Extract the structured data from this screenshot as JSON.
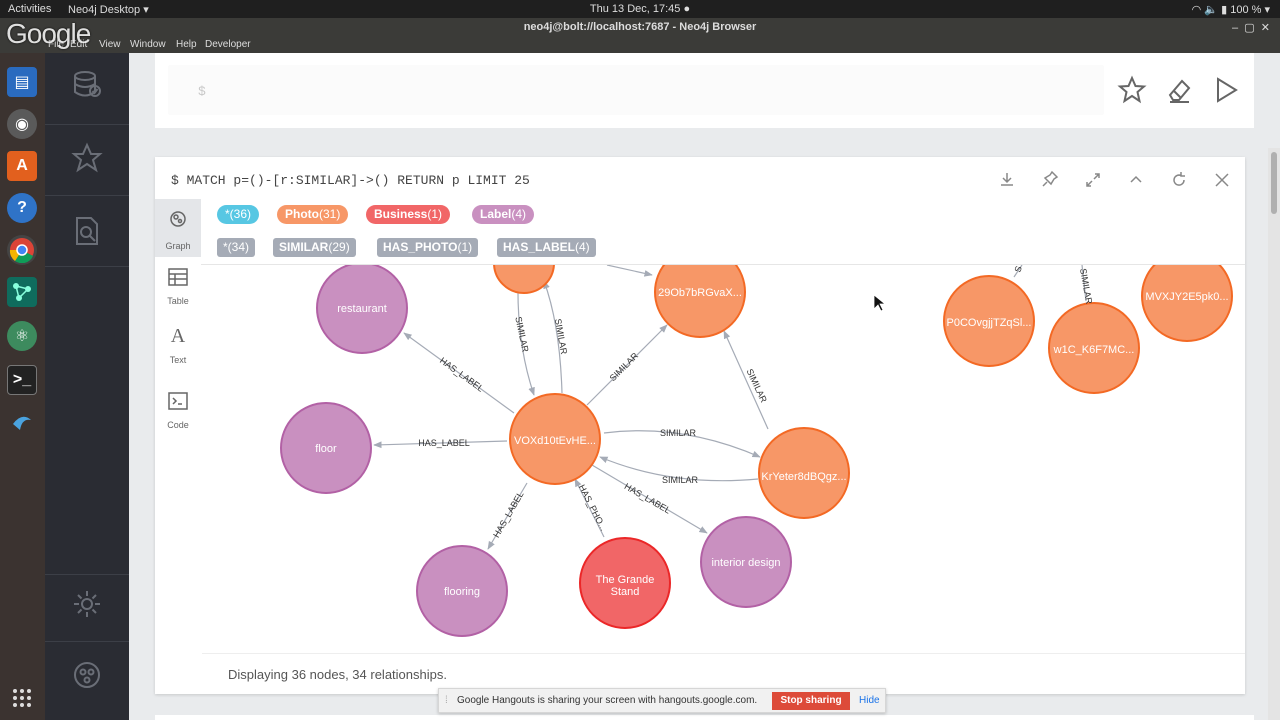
{
  "topbar": {
    "activities": "Activities",
    "app": "Neo4j Desktop ▾",
    "clock": "Thu 13 Dec, 17:45 ●",
    "battery": "100 % ▾"
  },
  "window": {
    "title": "neo4j@bolt://localhost:7687 - Neo4j Browser",
    "menus": [
      "File",
      "Edit",
      "View",
      "Window",
      "Help",
      "Developer"
    ]
  },
  "overlay_logo": "Google",
  "editor": {
    "prompt": "$"
  },
  "frame": {
    "query": "$ MATCH p=()-[r:SIMILAR]->() RETURN p LIMIT 25",
    "view_tabs": [
      "Graph",
      "Table",
      "Text",
      "Code"
    ],
    "node_labels": [
      {
        "name": "*",
        "count": "(36)",
        "color": "#57c7e3"
      },
      {
        "name": "Photo",
        "count": "(31)",
        "color": "#f79767"
      },
      {
        "name": "Business",
        "count": "(1)",
        "color": "#f16667"
      },
      {
        "name": "Label",
        "count": "(4)",
        "color": "#c990c0"
      }
    ],
    "rel_types": [
      {
        "name": "*",
        "count": "(34)"
      },
      {
        "name": "SIMILAR",
        "count": "(29)"
      },
      {
        "name": "HAS_PHOTO",
        "count": "(1)"
      },
      {
        "name": "HAS_LABEL",
        "count": "(4)"
      }
    ],
    "status": "Displaying 36 nodes, 34 relationships."
  },
  "graph": {
    "nodes": {
      "restaurant": "restaurant",
      "floor": "floor",
      "flooring": "flooring",
      "grande_1": "The Grande",
      "grande_2": "Stand",
      "interior": "interior design",
      "center": "VOXd10tEvHE...",
      "n29": "29Ob7bRGvaX...",
      "kry": "KrYeter8dBQgz...",
      "p0c": "P0COvgjjTZqSl...",
      "w1c": "w1C_K6F7MC...",
      "mvx": "MVXJY2E5pk0..."
    },
    "rels": {
      "similar": "SIMILAR",
      "has_label": "HAS_LABEL",
      "has_photo": "HAS_PHO..."
    }
  },
  "colors": {
    "photo": "#f79767",
    "label": "#c990c0",
    "business": "#f16667"
  },
  "hangouts": {
    "message": "Google Hangouts is sharing your screen with hangouts.google.com.",
    "stop": "Stop sharing",
    "hide": "Hide"
  }
}
